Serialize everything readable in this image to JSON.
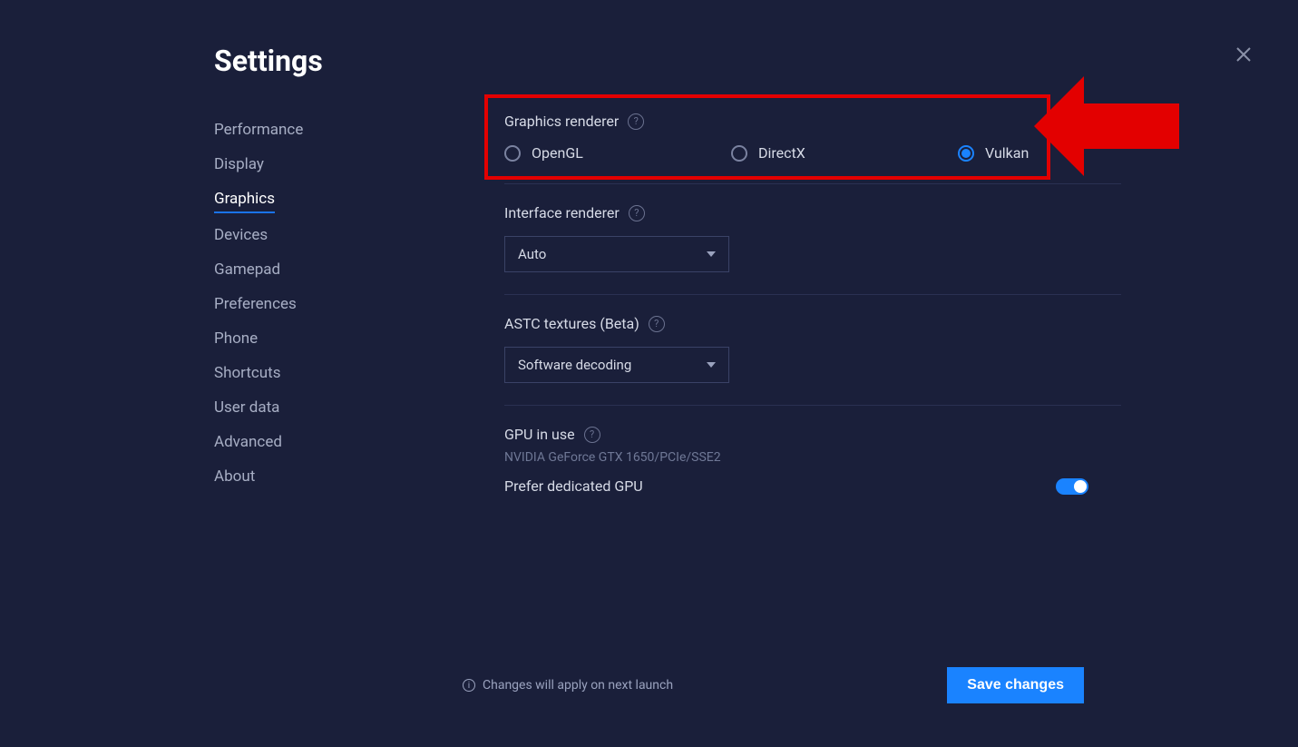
{
  "title": "Settings",
  "sidebar": {
    "items": [
      {
        "label": "Performance"
      },
      {
        "label": "Display"
      },
      {
        "label": "Graphics",
        "active": true
      },
      {
        "label": "Devices"
      },
      {
        "label": "Gamepad"
      },
      {
        "label": "Preferences"
      },
      {
        "label": "Phone"
      },
      {
        "label": "Shortcuts"
      },
      {
        "label": "User data"
      },
      {
        "label": "Advanced"
      },
      {
        "label": "About"
      }
    ]
  },
  "graphics_renderer": {
    "label": "Graphics renderer",
    "options": [
      "OpenGL",
      "DirectX",
      "Vulkan"
    ],
    "selected": "Vulkan"
  },
  "interface_renderer": {
    "label": "Interface renderer",
    "value": "Auto"
  },
  "astc": {
    "label": "ASTC textures (Beta)",
    "value": "Software decoding"
  },
  "gpu": {
    "label": "GPU in use",
    "info": "NVIDIA GeForce GTX 1650/PCIe/SSE2",
    "toggle_label": "Prefer dedicated GPU",
    "toggle_on": true
  },
  "footer": {
    "note": "Changes will apply on next launch",
    "save_label": "Save changes"
  }
}
